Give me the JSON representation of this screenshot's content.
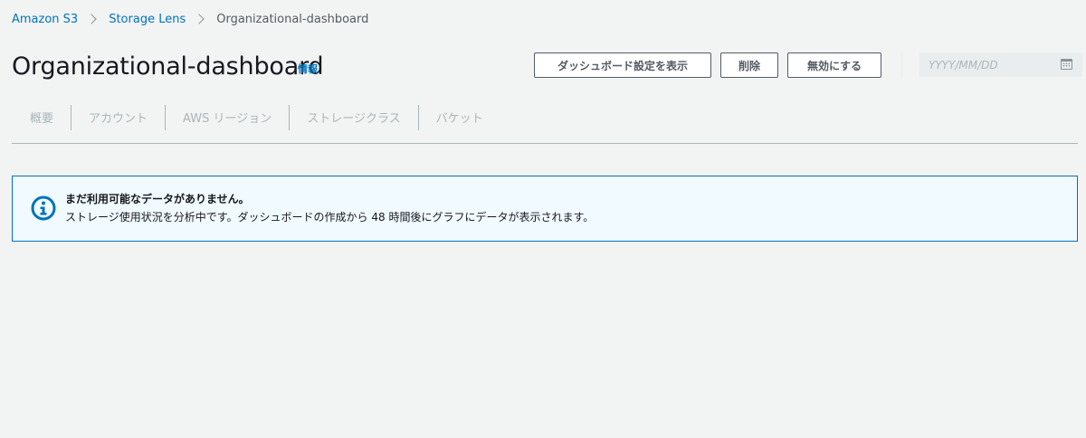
{
  "breadcrumb": {
    "items": [
      "Amazon S3",
      "Storage Lens"
    ],
    "current": "Organizational-dashboard"
  },
  "header": {
    "title": "Organizational-dashboard",
    "info_label": "情報"
  },
  "actions": {
    "view_settings": "ダッシュボード設定を表示",
    "delete": "削除",
    "disable": "無効にする"
  },
  "date_picker": {
    "placeholder": "YYYY/MM/DD",
    "value": ""
  },
  "tabs": [
    {
      "label": "概要"
    },
    {
      "label": "アカウント"
    },
    {
      "label": "AWS リージョン"
    },
    {
      "label": "ストレージクラス"
    },
    {
      "label": "バケット"
    }
  ],
  "alert": {
    "title": "まだ利用可能なデータがありません。",
    "message": "ストレージ使用状況を分析中です。ダッシュボードの作成から 48 時間後にグラフにデータが表示されます。"
  },
  "colors": {
    "link": "#0073bb",
    "alert_bg": "#f1faff",
    "alert_border": "#0073bb",
    "background": "#f2f3f3",
    "disabled_text": "#aab7b8"
  }
}
